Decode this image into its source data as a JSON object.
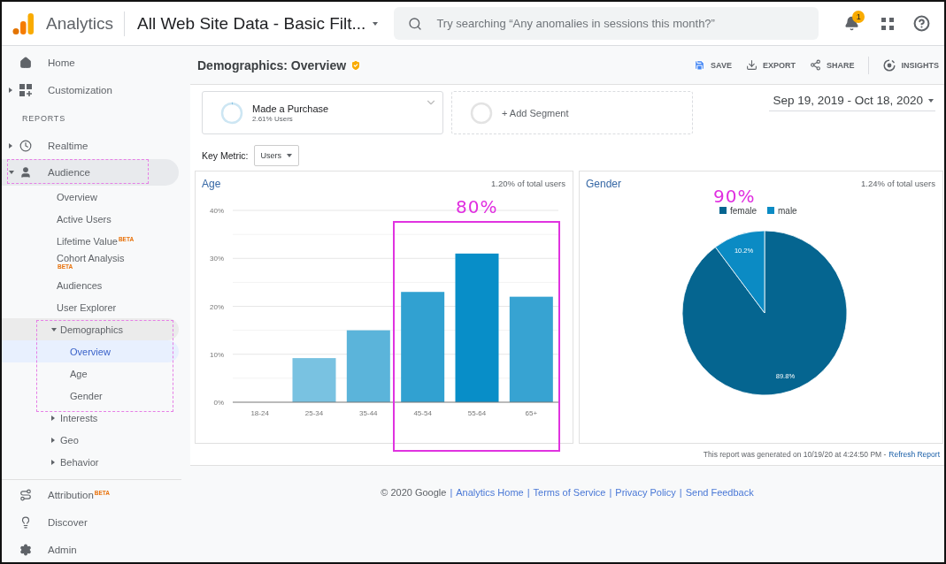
{
  "header": {
    "app_name": "Analytics",
    "property": "All Web Site Data - Basic Filt...",
    "search": {
      "placeholder": "Try searching “Any anomalies in sessions this month?”"
    },
    "notification_count": "1"
  },
  "sidebar": {
    "top": [
      {
        "label": "Home"
      },
      {
        "label": "Customization",
        "expanded": false
      }
    ],
    "section_label": "REPORTS",
    "reports": [
      {
        "label": "Realtime",
        "expanded": false
      },
      {
        "label": "Audience",
        "expanded": true,
        "children": [
          {
            "label": "Overview",
            "selected": false
          },
          {
            "label": "Active Users",
            "selected": false
          },
          {
            "label": "Lifetime Value",
            "badge": "BETA",
            "selected": false
          },
          {
            "label": "Cohort Analysis",
            "badge": "BETA",
            "selected": false
          },
          {
            "label": "Audiences",
            "selected": false
          },
          {
            "label": "User Explorer",
            "selected": false
          },
          {
            "label": "Demographics",
            "expanded": true,
            "children": [
              {
                "label": "Overview",
                "selected": true
              },
              {
                "label": "Age",
                "selected": false
              },
              {
                "label": "Gender",
                "selected": false
              }
            ]
          },
          {
            "label": "Interests",
            "expanded": false
          },
          {
            "label": "Geo",
            "expanded": false
          },
          {
            "label": "Behavior",
            "expanded": false
          }
        ]
      }
    ],
    "bottom": [
      {
        "label": "Attribution",
        "badge": "BETA"
      },
      {
        "label": "Discover"
      },
      {
        "label": "Admin"
      }
    ]
  },
  "report": {
    "title": "Demographics: Overview",
    "actions": [
      "SAVE",
      "EXPORT",
      "SHARE",
      "INSIGHTS"
    ],
    "segments": [
      {
        "kind": "applied",
        "name": "Made a Purchase",
        "detail": "2.61% Users"
      },
      {
        "kind": "add",
        "name": "+ Add Segment"
      }
    ],
    "date_range": "Sep 19, 2019 - Oct 18, 2020",
    "key_metric": {
      "label": "Key Metric:",
      "value": "Users"
    },
    "age": {
      "note": "1.20% of total users",
      "chart_data": {
        "type": "bar",
        "title": "Age",
        "categories": [
          "18-24",
          "25-34",
          "35-44",
          "45-54",
          "55-64",
          "65+"
        ],
        "series": [
          {
            "values": [
              0,
              9.2,
              15,
              23,
              31,
              22
            ]
          }
        ],
        "grid": true,
        "ylim": [
          0,
          40
        ],
        "yticks": [
          {
            "value": 0,
            "label": "0%"
          },
          {
            "value": 10,
            "label": "10%"
          },
          {
            "value": 20,
            "label": "20%"
          },
          {
            "value": 30,
            "label": "30%"
          },
          {
            "value": 40,
            "label": "40%"
          }
        ]
      }
    },
    "gender": {
      "note": "1.24% of total users",
      "chart_data": {
        "type": "pie",
        "title": "Gender",
        "categories": [
          "female",
          "male"
        ],
        "series": [
          {
            "values": [
              89.8,
              10.2
            ]
          }
        ],
        "legend": "top",
        "value_labels": [
          "89.8%",
          "10.2%"
        ]
      }
    },
    "generated": "This report was generated on 10/19/20 at 4:24:50 PM -",
    "refresh_link": "Refresh Report"
  },
  "footer": {
    "copyright": "© 2020 Google",
    "separator": "|",
    "links": [
      "Analytics Home",
      "Terms of Service",
      "Privacy Policy",
      "Send Feedback"
    ]
  },
  "annotations": [
    {
      "kind": "dashed-box"
    },
    {
      "kind": "dashed-box"
    },
    {
      "kind": "box"
    },
    {
      "kind": "label",
      "text": "80%"
    },
    {
      "kind": "label",
      "text": "90%"
    }
  ]
}
